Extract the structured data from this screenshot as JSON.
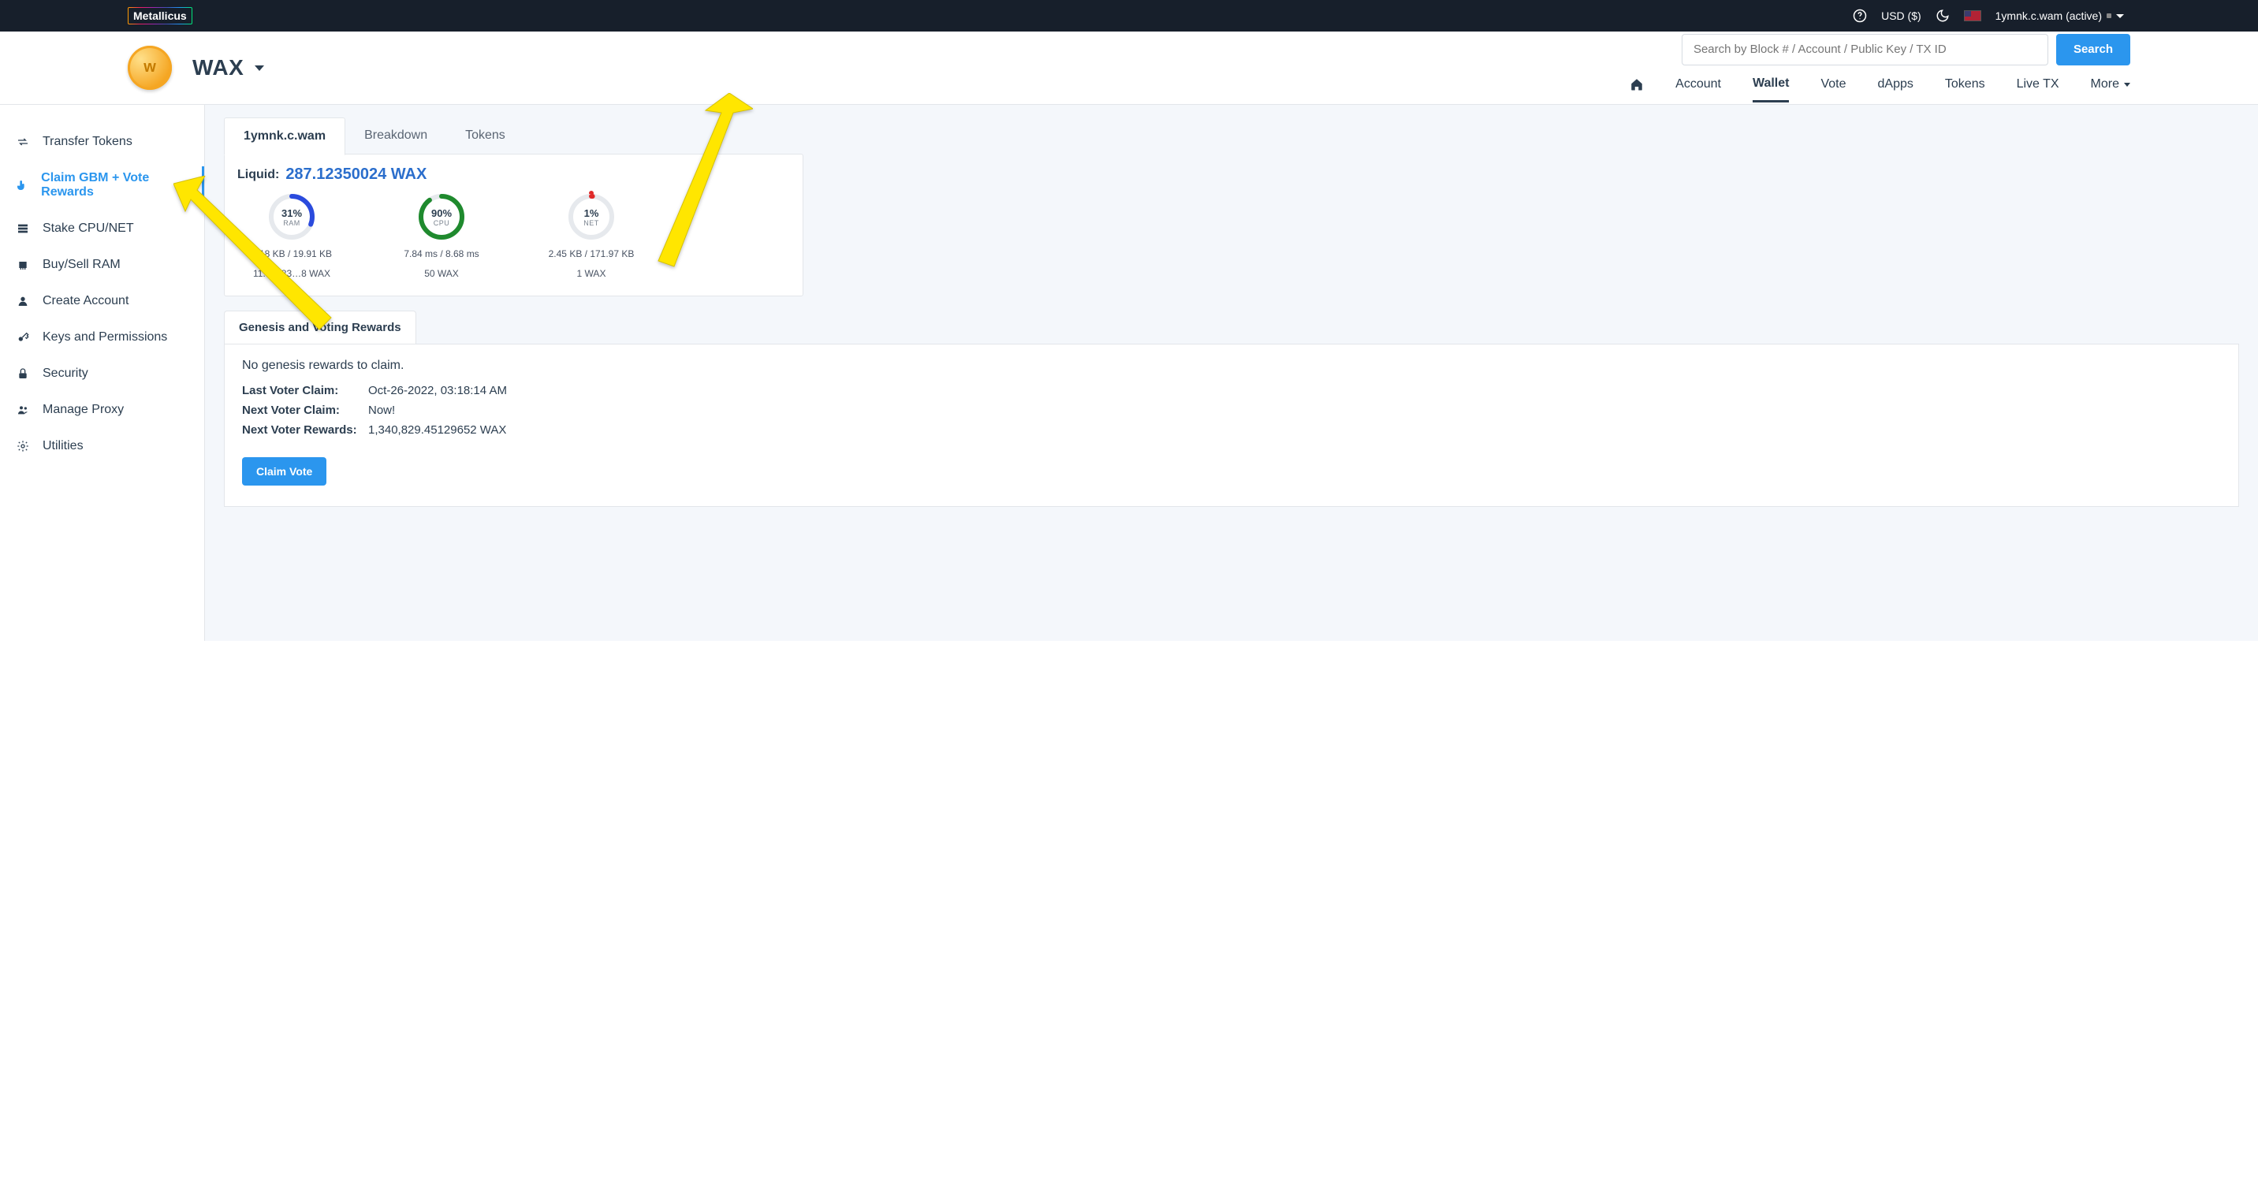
{
  "topbar": {
    "brand": "Metallicus",
    "currency": "USD ($)",
    "account_label": "1ymnk.c.wam (active)"
  },
  "header": {
    "chain_name": "WAX",
    "search_placeholder": "Search by Block # / Account / Public Key / TX ID",
    "search_button": "Search",
    "nav": {
      "account": "Account",
      "wallet": "Wallet",
      "vote": "Vote",
      "dapps": "dApps",
      "tokens": "Tokens",
      "livetx": "Live TX",
      "more": "More"
    }
  },
  "sidebar": {
    "transfer": "Transfer Tokens",
    "claim": "Claim GBM + Vote Rewards",
    "stake": "Stake CPU/NET",
    "ram": "Buy/Sell RAM",
    "create": "Create Account",
    "keys": "Keys and Permissions",
    "security": "Security",
    "proxy": "Manage Proxy",
    "utilities": "Utilities"
  },
  "wallet": {
    "tabs": {
      "account": "1ymnk.c.wam",
      "breakdown": "Breakdown",
      "tokens": "Tokens"
    },
    "liquid_label": "Liquid:",
    "liquid_value": "287.12350024 WAX",
    "gauges": {
      "ram": {
        "pct": "31%",
        "label": "RAM",
        "line1": "6.18 KB / 19.91 KB",
        "line2": "11.33083…8 WAX",
        "value": 31,
        "color": "#2b4bdd"
      },
      "cpu": {
        "pct": "90%",
        "label": "CPU",
        "line1": "7.84 ms / 8.68 ms",
        "line2": "50 WAX",
        "value": 90,
        "color": "#1f8a2e"
      },
      "net": {
        "pct": "1%",
        "label": "NET",
        "line1": "2.45 KB / 171.97 KB",
        "line2": "1 WAX",
        "value": 1,
        "color": "#e02a2a"
      }
    }
  },
  "rewards": {
    "tab_title": "Genesis and Voting Rewards",
    "no_genesis": "No genesis rewards to claim.",
    "rows": {
      "last_claim_k": "Last Voter Claim:",
      "last_claim_v": "Oct-26-2022, 03:18:14 AM",
      "next_claim_k": "Next Voter Claim:",
      "next_claim_v": "Now!",
      "rewards_k": "Next Voter Rewards:",
      "rewards_v": "1,340,829.45129652 WAX"
    },
    "claim_button": "Claim Vote"
  }
}
